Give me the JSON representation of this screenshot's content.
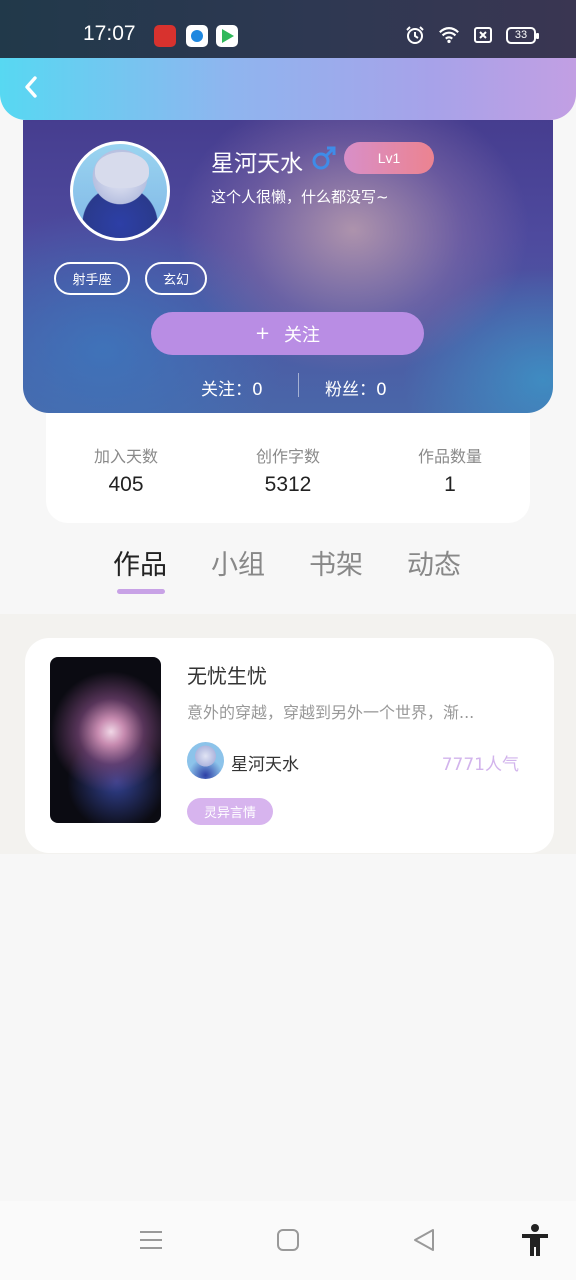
{
  "status_bar": {
    "time": "17:07",
    "battery": "33",
    "icons": [
      "app-icon-red",
      "app-icon-blue",
      "app-icon-play",
      "alarm-icon",
      "wifi-icon",
      "sim-icon",
      "battery-icon"
    ]
  },
  "header": {
    "back_icon": "chevron-left-icon"
  },
  "profile": {
    "username": "星河天水",
    "gender_icon": "male-icon",
    "level": "Lv1",
    "bio": "这个人很懒，什么都没写~",
    "tags": [
      "射手座",
      "玄幻"
    ],
    "follow_button": {
      "icon": "+",
      "label": "关注"
    },
    "following": "关注：0",
    "followers": "粉丝：0"
  },
  "stats": [
    {
      "label": "加入天数",
      "value": "405"
    },
    {
      "label": "创作字数",
      "value": "5312"
    },
    {
      "label": "作品数量",
      "value": "1"
    }
  ],
  "tabs": [
    {
      "label": "作品",
      "active": true
    },
    {
      "label": "小组",
      "active": false
    },
    {
      "label": "书架",
      "active": false
    },
    {
      "label": "动态",
      "active": false
    }
  ],
  "works": [
    {
      "title": "无忧生忧",
      "description": "意外的穿越，穿越到另外一个世界，渐...",
      "author": "星河天水",
      "popularity": "7771人气",
      "genre": "灵异言情"
    }
  ],
  "colors": {
    "accent": "#b98de4",
    "level_badge": "#ec8390",
    "genre_tag": "#d7b4ee",
    "popularity": "#d2b4ec"
  }
}
